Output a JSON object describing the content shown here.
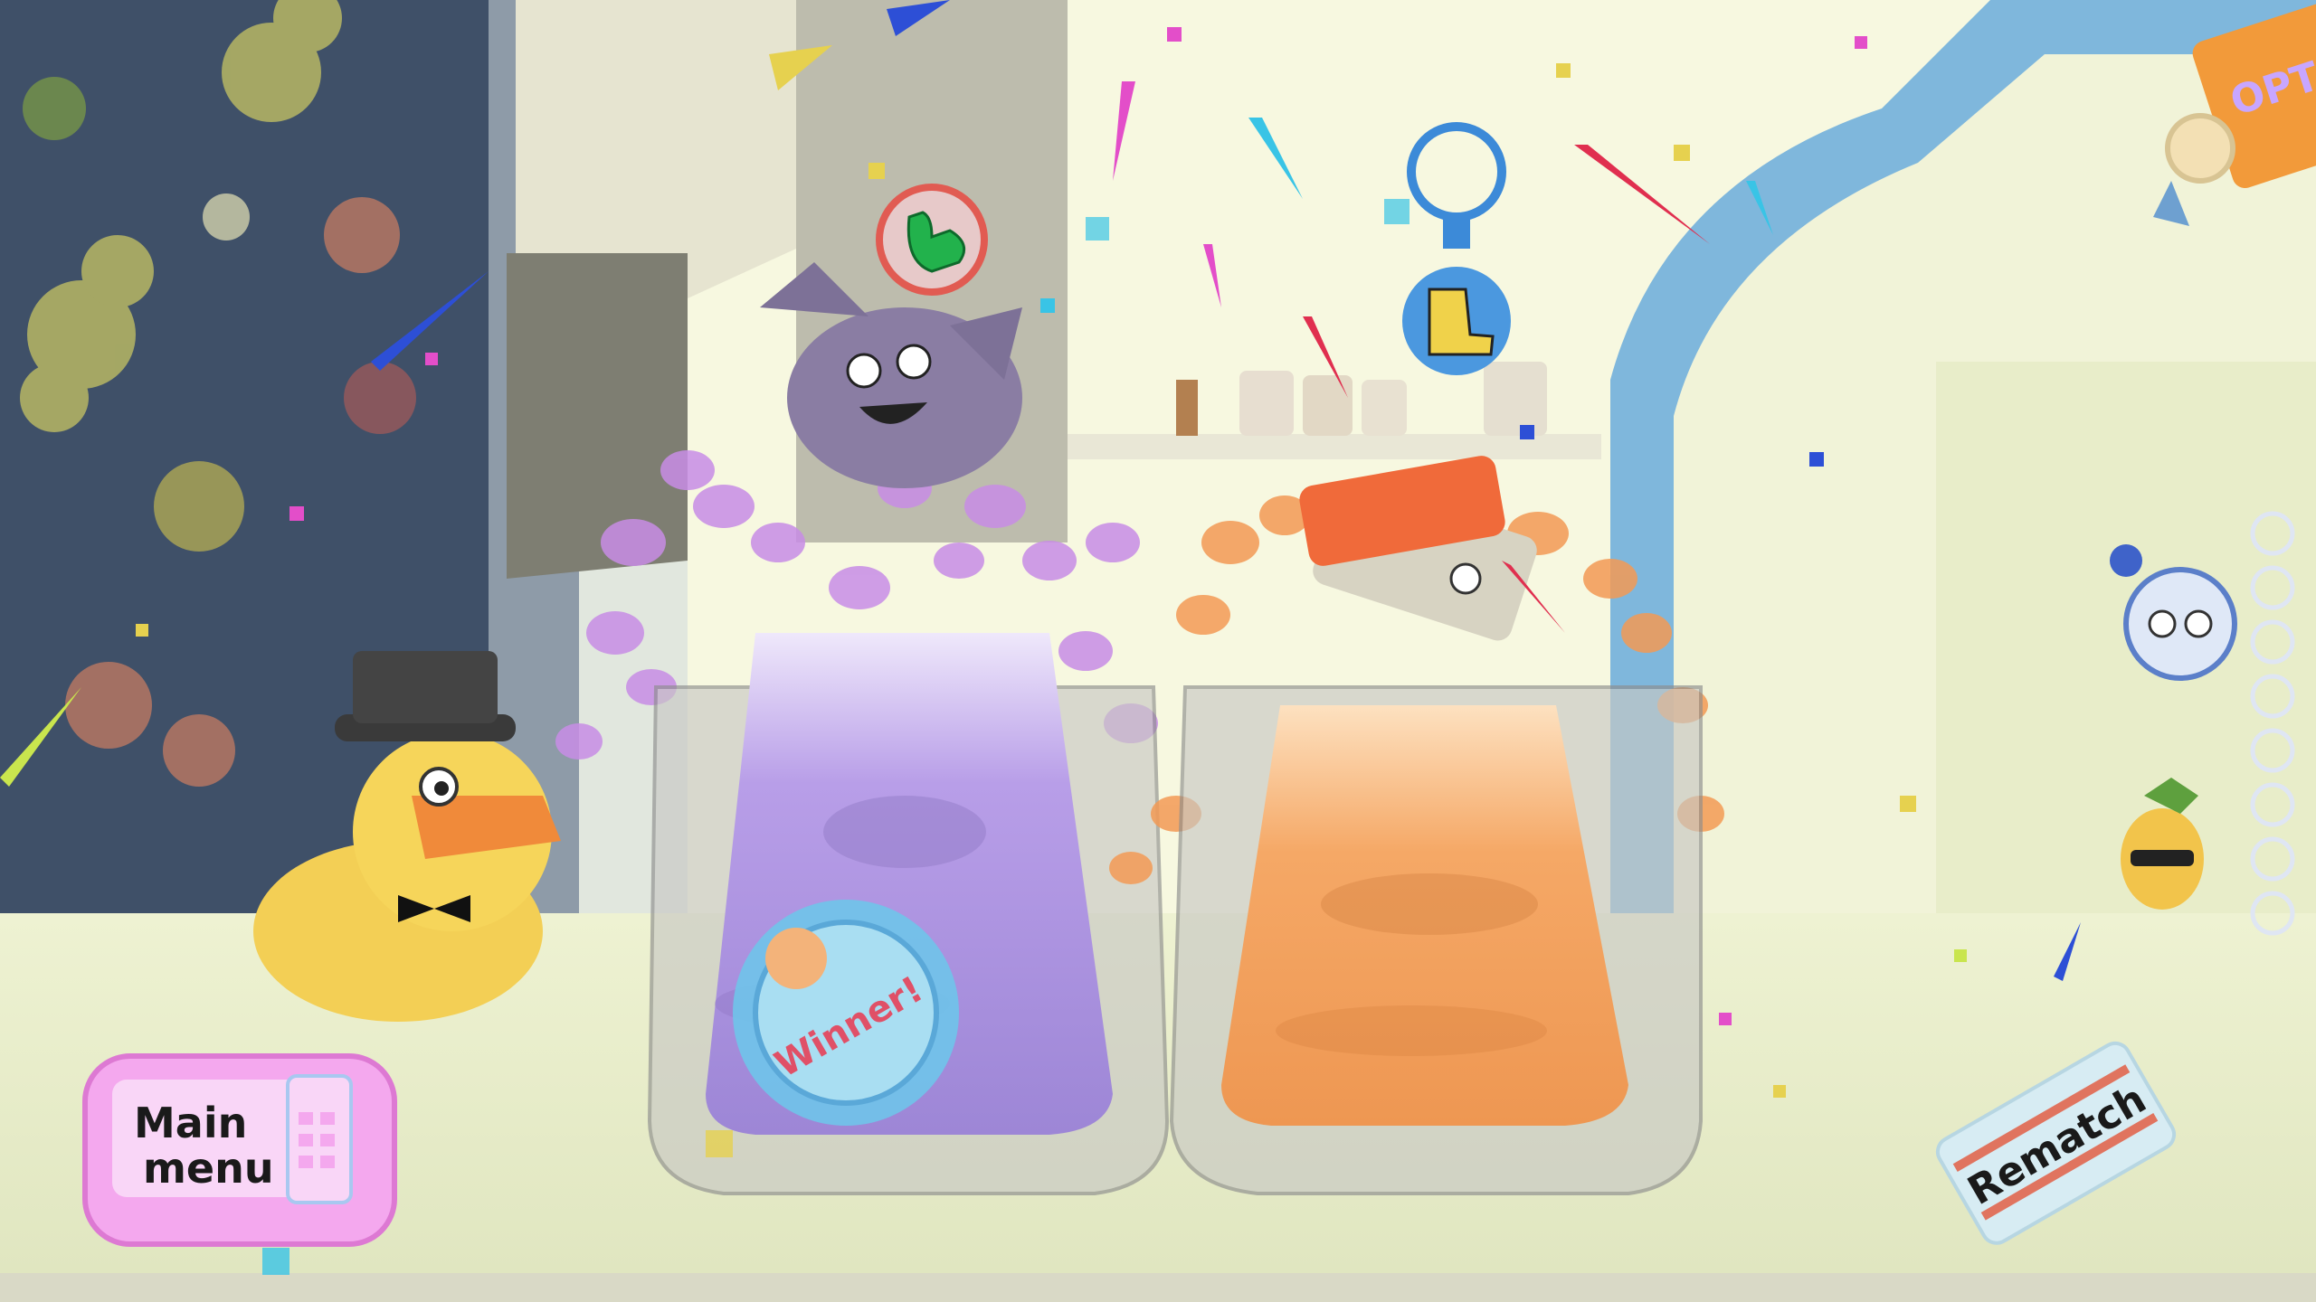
{
  "screen": "match-results",
  "buttons": {
    "main_menu_line1": "Main",
    "main_menu_line2": "menu",
    "rematch": "Rematch"
  },
  "winner_badge": {
    "text": "Winner!"
  },
  "options_sign": {
    "text": "OPTIONS"
  },
  "players": [
    {
      "slot": "left",
      "character": "purple-plush-cat",
      "powerup_icon": "muscle-arm-icon",
      "jar_color": "#b9a3f0",
      "result": "winner"
    },
    {
      "slot": "right",
      "character": "salmon-sushi",
      "powerup_icon": "speed-boot-icon",
      "jar_color": "#f6a564",
      "result": "loser"
    }
  ],
  "queue_icons": [
    "robot-ball-icon",
    "pineapple-sunglasses-icon"
  ],
  "colors": {
    "counter": "#e7eccb",
    "wall": "#fafbe4",
    "window": "#3d4e62",
    "purple_splash": "#c88de6",
    "orange_splash": "#f39a55",
    "main_menu_bg": "#f4a8ee",
    "rematch_bg": "#cfe8f1"
  }
}
